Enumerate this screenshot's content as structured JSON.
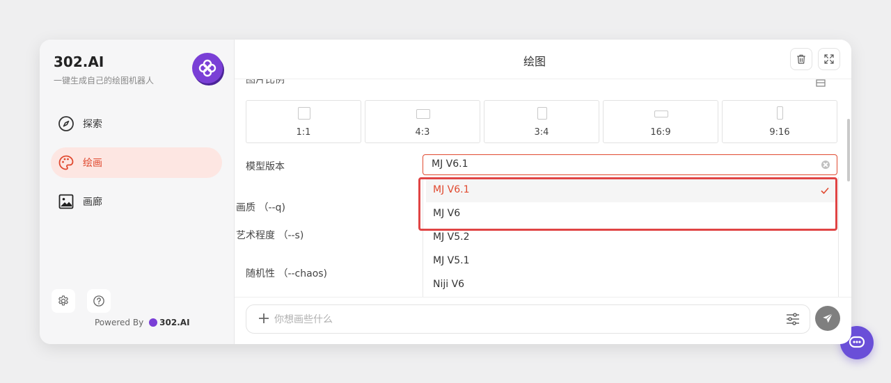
{
  "sidebar": {
    "brand_title": "302.AI",
    "brand_subtitle": "一键生成自己的绘图机器人",
    "logo_icon": "flower-logo-icon",
    "items": [
      {
        "label": "探索",
        "icon": "compass-icon",
        "active": false
      },
      {
        "label": "绘画",
        "icon": "palette-icon",
        "active": true
      },
      {
        "label": "画廊",
        "icon": "image-icon",
        "active": false
      }
    ],
    "footer": {
      "settings_icon": "gear-icon",
      "help_icon": "help-circle-icon",
      "powered_label": "Powered By",
      "powered_brand": "302.AI"
    }
  },
  "header": {
    "title": "绘图",
    "delete_icon": "trash-icon",
    "fullscreen_icon": "expand-icon"
  },
  "form": {
    "aspect_section_label": "图片比例",
    "aspect_ratios": [
      {
        "label": "1:1"
      },
      {
        "label": "4:3"
      },
      {
        "label": "3:4"
      },
      {
        "label": "16:9"
      },
      {
        "label": "9:16"
      }
    ],
    "model_label": "模型版本",
    "model_value": "MJ V6.1",
    "quality_label": "画质 （--q)",
    "stylize_label": "艺术程度 （--s)",
    "chaos_label": "随机性 （--chaos)"
  },
  "dropdown": {
    "options": [
      {
        "label": "MJ V6.1",
        "selected": true
      },
      {
        "label": "MJ V6",
        "selected": false
      },
      {
        "label": "MJ V5.2",
        "selected": false
      },
      {
        "label": "MJ V5.1",
        "selected": false
      },
      {
        "label": "Niji V6",
        "selected": false
      }
    ]
  },
  "prompt": {
    "placeholder": "你想画些什么",
    "value": ""
  },
  "colors": {
    "accent": "#e0492f",
    "brand_purple": "#7a3fd6",
    "highlight_red": "#e04444",
    "chat_fab": "#6a4fd8"
  }
}
